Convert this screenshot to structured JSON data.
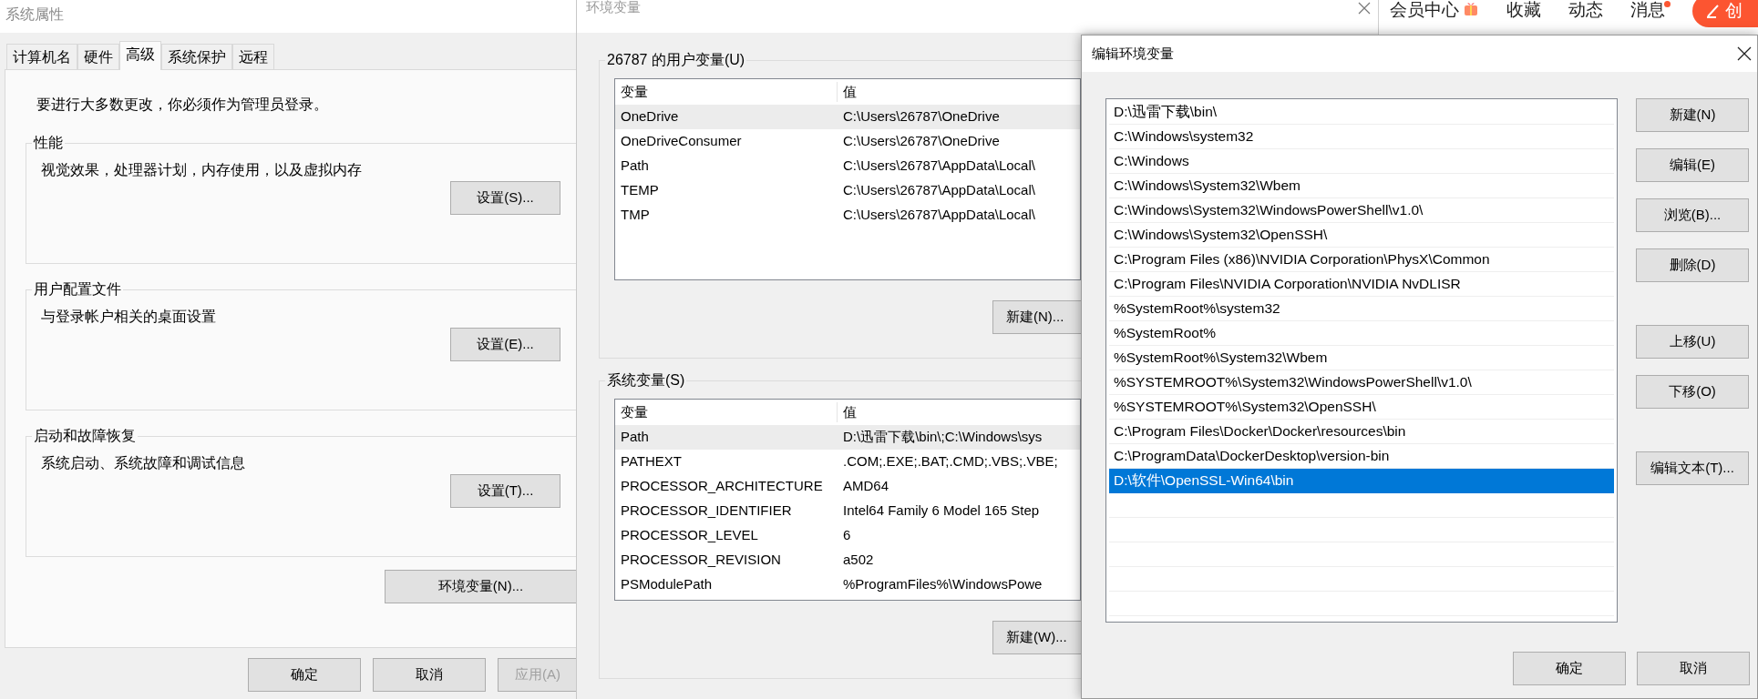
{
  "system_properties": {
    "title": "系统属性",
    "tabs": [
      {
        "label": "计算机名",
        "selected": false
      },
      {
        "label": "硬件",
        "selected": false
      },
      {
        "label": "高级",
        "selected": true
      },
      {
        "label": "系统保护",
        "selected": false
      },
      {
        "label": "远程",
        "selected": false
      }
    ],
    "notice": "要进行大多数更改，你必须作为管理员登录。",
    "groups": [
      {
        "title": "性能",
        "description": "视觉效果，处理器计划，内存使用，以及虚拟内存",
        "button": "设置(S)..."
      },
      {
        "title": "用户配置文件",
        "description": "与登录帐户相关的桌面设置",
        "button": "设置(E)..."
      },
      {
        "title": "启动和故障恢复",
        "description": "系统启动、系统故障和调试信息",
        "button": "设置(T)..."
      }
    ],
    "env_button": "环境变量(N)...",
    "buttons": [
      {
        "label": "确定",
        "disabled": false
      },
      {
        "label": "取消",
        "disabled": false
      },
      {
        "label": "应用(A)",
        "disabled": true
      }
    ]
  },
  "environment_variables": {
    "title": "环境变量",
    "sections": [
      {
        "title": "26787 的用户变量(U)",
        "columns": [
          "变量",
          "值"
        ],
        "rows": [
          {
            "name": "OneDrive",
            "value": "C:\\Users\\26787\\OneDrive",
            "selected": true
          },
          {
            "name": "OneDriveConsumer",
            "value": "C:\\Users\\26787\\OneDrive",
            "selected": false
          },
          {
            "name": "Path",
            "value": "C:\\Users\\26787\\AppData\\Local\\",
            "selected": false
          },
          {
            "name": "TEMP",
            "value": "C:\\Users\\26787\\AppData\\Local\\",
            "selected": false
          },
          {
            "name": "TMP",
            "value": "C:\\Users\\26787\\AppData\\Local\\",
            "selected": false
          }
        ],
        "button": "新建(N)..."
      },
      {
        "title": "系统变量(S)",
        "columns": [
          "变量",
          "值"
        ],
        "rows": [
          {
            "name": "Path",
            "value": "D:\\迅雷下载\\bin\\;C:\\Windows\\sys",
            "selected": true
          },
          {
            "name": "PATHEXT",
            "value": ".COM;.EXE;.BAT;.CMD;.VBS;.VBE;",
            "selected": false
          },
          {
            "name": "PROCESSOR_ARCHITECTURE",
            "value": "AMD64",
            "selected": false
          },
          {
            "name": "PROCESSOR_IDENTIFIER",
            "value": "Intel64 Family 6 Model 165 Step",
            "selected": false
          },
          {
            "name": "PROCESSOR_LEVEL",
            "value": "6",
            "selected": false
          },
          {
            "name": "PROCESSOR_REVISION",
            "value": "a502",
            "selected": false
          },
          {
            "name": "PSModulePath",
            "value": "%ProgramFiles%\\WindowsPowe",
            "selected": false
          }
        ],
        "button": "新建(W)..."
      }
    ]
  },
  "edit_environment_variable": {
    "title": "编辑环境变量",
    "entries": [
      {
        "text": "D:\\迅雷下载\\bin\\",
        "selected": false
      },
      {
        "text": "C:\\Windows\\system32",
        "selected": false
      },
      {
        "text": "C:\\Windows",
        "selected": false
      },
      {
        "text": "C:\\Windows\\System32\\Wbem",
        "selected": false
      },
      {
        "text": "C:\\Windows\\System32\\WindowsPowerShell\\v1.0\\",
        "selected": false
      },
      {
        "text": "C:\\Windows\\System32\\OpenSSH\\",
        "selected": false
      },
      {
        "text": "C:\\Program Files (x86)\\NVIDIA Corporation\\PhysX\\Common",
        "selected": false
      },
      {
        "text": "C:\\Program Files\\NVIDIA Corporation\\NVIDIA NvDLISR",
        "selected": false
      },
      {
        "text": "%SystemRoot%\\system32",
        "selected": false
      },
      {
        "text": "%SystemRoot%",
        "selected": false
      },
      {
        "text": "%SystemRoot%\\System32\\Wbem",
        "selected": false
      },
      {
        "text": "%SYSTEMROOT%\\System32\\WindowsPowerShell\\v1.0\\",
        "selected": false
      },
      {
        "text": "%SYSTEMROOT%\\System32\\OpenSSH\\",
        "selected": false
      },
      {
        "text": "C:\\Program Files\\Docker\\Docker\\resources\\bin",
        "selected": false
      },
      {
        "text": "C:\\ProgramData\\DockerDesktop\\version-bin",
        "selected": false
      },
      {
        "text": "D:\\软件\\OpenSSL-Win64\\bin",
        "selected": true
      }
    ],
    "side_button_groups": [
      [
        "新建(N)",
        "编辑(E)",
        "浏览(B)...",
        "删除(D)"
      ],
      [
        "上移(U)",
        "下移(O)"
      ],
      [
        "编辑文本(T)..."
      ]
    ],
    "buttons": [
      "确定",
      "取消"
    ]
  },
  "browser_header": {
    "links": [
      {
        "label": "会员中心",
        "kind": "gift"
      },
      {
        "label": "收藏",
        "kind": "plain"
      },
      {
        "label": "动态",
        "kind": "plain"
      },
      {
        "label": "消息",
        "kind": "unread"
      }
    ],
    "create_button": "创"
  }
}
